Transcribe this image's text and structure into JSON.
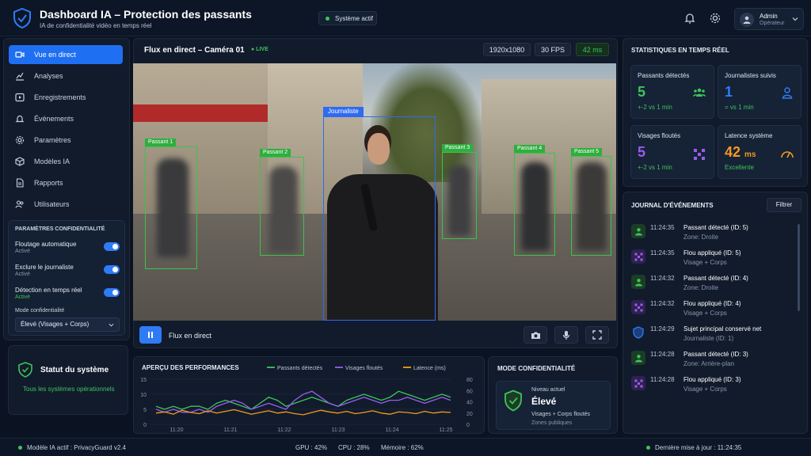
{
  "header": {
    "title": "Dashboard IA – Protection des passants",
    "subtitle": "IA de confidentialité vidéo en temps réel",
    "system_status": "Système actif",
    "user_name": "Admin",
    "user_role": "Opérateur"
  },
  "sidebar": {
    "items": [
      {
        "label": "Vue en direct",
        "icon": "video-icon",
        "active": true
      },
      {
        "label": "Analyses",
        "icon": "chart-icon"
      },
      {
        "label": "Enregistrements",
        "icon": "play-icon"
      },
      {
        "label": "Événements",
        "icon": "bell-icon"
      },
      {
        "label": "Paramètres",
        "icon": "gear-icon"
      },
      {
        "label": "Modèles IA",
        "icon": "cube-icon"
      },
      {
        "label": "Rapports",
        "icon": "file-icon"
      },
      {
        "label": "Utilisateurs",
        "icon": "users-icon"
      }
    ],
    "privacy": {
      "title": "PARAMÈTRES CONFIDENTIALITÉ",
      "settings": [
        {
          "label": "Floutage automatique",
          "status": "Activé"
        },
        {
          "label": "Exclure le journaliste",
          "status": "Activé"
        },
        {
          "label": "Détection en temps réel",
          "status": "Activé"
        }
      ],
      "mode_label": "Mode confidentialité",
      "mode_value": "Élevé (Visages + Corps)"
    },
    "system": {
      "title": "Statut du système",
      "status": "Tous les systèmes opérationnels"
    }
  },
  "video": {
    "title": "Flux en direct – Caméra 01",
    "live": "LIVE",
    "resolution": "1920x1080",
    "fps": "30 FPS",
    "latency": "42 ms",
    "footer_label": "Flux en direct",
    "boxes": [
      {
        "label": "Journaliste",
        "type": "journalist"
      },
      {
        "label": "Passant 1"
      },
      {
        "label": "Passant 2"
      },
      {
        "label": "Passant 3"
      },
      {
        "label": "Passant 4"
      },
      {
        "label": "Passant 5"
      }
    ]
  },
  "stats": {
    "title": "STATISTIQUES EN TEMPS RÉEL",
    "cards": [
      {
        "label": "Passants détectés",
        "value": "5",
        "sub": "+-2 vs 1 min",
        "color": "#3fc45a"
      },
      {
        "label": "Journalistes suivis",
        "value": "1",
        "sub": "= vs 1 min",
        "color": "#2f7bf6"
      },
      {
        "label": "Visages floutés",
        "value": "5",
        "sub": "+-2 vs 1 min",
        "color": "#9a5cf0"
      },
      {
        "label": "Latence système",
        "value": "42",
        "unit": "ms",
        "sub": "Excellente",
        "color": "#f39a1e"
      }
    ]
  },
  "events": {
    "title": "JOURNAL D'ÉVÉNEMENTS",
    "filter_label": "Filtrer",
    "items": [
      {
        "time": "11:24:35",
        "title": "Passant détecté (ID: 5)",
        "detail": "Zone: Droite",
        "kind": "person"
      },
      {
        "time": "11:24:35",
        "title": "Flou appliqué (ID: 5)",
        "detail": "Visage + Corps",
        "kind": "blur"
      },
      {
        "time": "11:24:32",
        "title": "Passant détecté (ID: 4)",
        "detail": "Zone: Droite",
        "kind": "person"
      },
      {
        "time": "11:24:32",
        "title": "Flou appliqué (ID: 4)",
        "detail": "Visage + Corps",
        "kind": "blur"
      },
      {
        "time": "11:24:29",
        "title": "Sujet principal conservé net",
        "detail": "Journaliste (ID: 1)",
        "kind": "shield"
      },
      {
        "time": "11:24:28",
        "title": "Passant détecté (ID: 3)",
        "detail": "Zone: Arrière-plan",
        "kind": "person"
      },
      {
        "time": "11:24:28",
        "title": "Flou appliqué (ID: 3)",
        "detail": "Visage + Corps",
        "kind": "blur"
      }
    ]
  },
  "performance": {
    "title": "APERÇU DES PERFORMANCES"
  },
  "chart_data": {
    "type": "line",
    "x": [
      "11:20",
      "11:21",
      "11:22",
      "11:23",
      "11:24",
      "11:25"
    ],
    "ylim_left": [
      0,
      15
    ],
    "yticks_left": [
      0,
      5,
      10,
      15
    ],
    "ylim_right": [
      0,
      80
    ],
    "yticks_right": [
      0,
      20,
      40,
      60,
      80
    ],
    "grid": true,
    "legend": "top",
    "series": [
      {
        "name": "Passants détectés",
        "color": "#3fc45a",
        "axis": "left",
        "values": [
          6,
          5,
          6,
          5,
          6,
          6,
          5,
          7,
          8,
          7,
          6,
          5,
          7,
          9,
          8,
          6,
          7,
          8,
          9,
          8,
          7,
          6,
          8,
          9,
          10,
          9,
          8,
          9,
          11,
          10,
          9,
          8,
          9,
          10,
          9
        ]
      },
      {
        "name": "Visages floutés",
        "color": "#9a5cf0",
        "axis": "left",
        "values": [
          5,
          4,
          5,
          4,
          4,
          5,
          4,
          6,
          7,
          8,
          7,
          5,
          6,
          7,
          6,
          5,
          8,
          10,
          11,
          9,
          7,
          6,
          7,
          8,
          9,
          8,
          7,
          8,
          8,
          9,
          8,
          7,
          8,
          9,
          8
        ]
      },
      {
        "name": "Latence (ms)",
        "color": "#f39a1e",
        "axis": "right",
        "values": [
          20,
          22,
          18,
          25,
          21,
          19,
          24,
          20,
          23,
          26,
          22,
          18,
          21,
          24,
          20,
          22,
          19,
          17,
          21,
          25,
          22,
          20,
          23,
          19,
          21,
          24,
          20,
          18,
          22,
          21,
          19,
          23,
          20,
          22,
          21
        ]
      }
    ]
  },
  "mode": {
    "title": "MODE CONFIDENTIALITÉ",
    "current_label": "Niveau actuel",
    "current_value": "Élevé",
    "line1": "Visages + Corps floutés",
    "line2": "Zones publiques"
  },
  "footer": {
    "model": "Modèle IA actif : PrivacyGuard v2.4",
    "gpu": "GPU : 42%",
    "cpu": "CPU : 28%",
    "memory": "Mémoire : 62%",
    "last_update": "Dernière mise à jour : 11:24:35"
  }
}
